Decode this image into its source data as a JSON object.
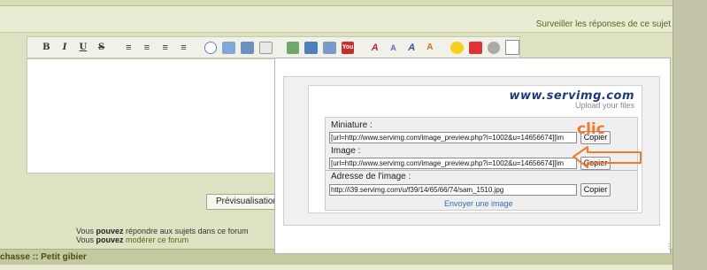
{
  "header": {
    "subscribe_link": "Surveiller les réponses de ce sujet"
  },
  "toolbar": {
    "bold": "B",
    "italic": "I",
    "underline": "U",
    "strike": "S",
    "icons": [
      "align-left-icon",
      "align-center-icon",
      "align-right-icon",
      "align-justify-icon",
      "speech-bubble-icon",
      "code-icon",
      "image-icon",
      "quote-icon",
      "table-icon",
      "insert-image-icon",
      "link-icon",
      "youtube-icon",
      "font-icon",
      "size-icon",
      "color-icon",
      "clear-icon",
      "smiley-icon",
      "calendar-icon",
      "settings-icon",
      "source-icon"
    ],
    "youtube_label": "You"
  },
  "preview_button": "Prévisualisation",
  "permissions": {
    "line1_a": "Vous ",
    "line1_b": "pouvez",
    "line1_c": " répondre aux sujets dans ce forum",
    "line2_a": "Vous ",
    "line2_b": "pouvez",
    "line2_c": " modérer ce forum"
  },
  "breadcrumb": "chasse :: Petit gibier",
  "popup": {
    "logo": "www.servimg.com",
    "logo_sub": "Upload your files",
    "miniature_label": "Miniature :",
    "miniature_value": "[url=http://www.servimg.com/image_preview.php?i=1002&u=14656674][im",
    "image_label": "Image :",
    "image_value": "[url=http://www.servimg.com/image_preview.php?i=1002&u=14656674][im",
    "address_label": "Adresse de l'image :",
    "address_value": "http://i39.servimg.com/u/f39/14/65/66/74/sam_1510.jpg",
    "copy_label": "Copier",
    "send_link": "Envoyer une image"
  },
  "annotation": {
    "clic": "clic",
    "color": "#f2782a"
  }
}
